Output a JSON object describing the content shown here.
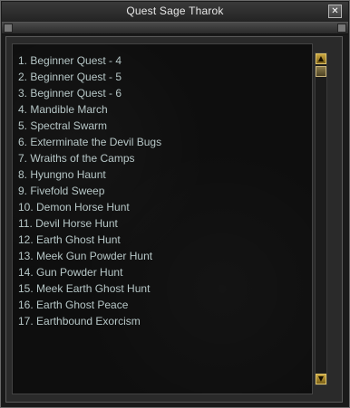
{
  "window": {
    "title": "Quest Sage Tharok",
    "close_symbol": "✕"
  },
  "quests": [
    "1. Beginner Quest - 4",
    "2. Beginner Quest - 5",
    "3. Beginner Quest - 6",
    "4. Mandible March",
    "5. Spectral Swarm",
    "6. Exterminate the Devil Bugs",
    "7. Wraiths of the Camps",
    "8. Hyungno Haunt",
    "9. Fivefold Sweep",
    "10. Demon Horse Hunt",
    "11. Devil Horse Hunt",
    "12. Earth Ghost Hunt",
    "13. Meek Gun Powder Hunt",
    "14. Gun Powder Hunt",
    "15. Meek Earth Ghost Hunt",
    "16. Earth Ghost Peace",
    "17. Earthbound Exorcism"
  ],
  "scrollbar": {
    "up_symbol": "▲",
    "down_symbol": "▼",
    "position": 0.0
  },
  "colors": {
    "quest_text": "#b7c7c7",
    "title_text": "#e8e8e8",
    "scroll_accent": "#c9a640"
  },
  "icons": {
    "close": "close-icon",
    "scroll_up": "arrow-up-icon",
    "scroll_down": "arrow-down-icon"
  }
}
